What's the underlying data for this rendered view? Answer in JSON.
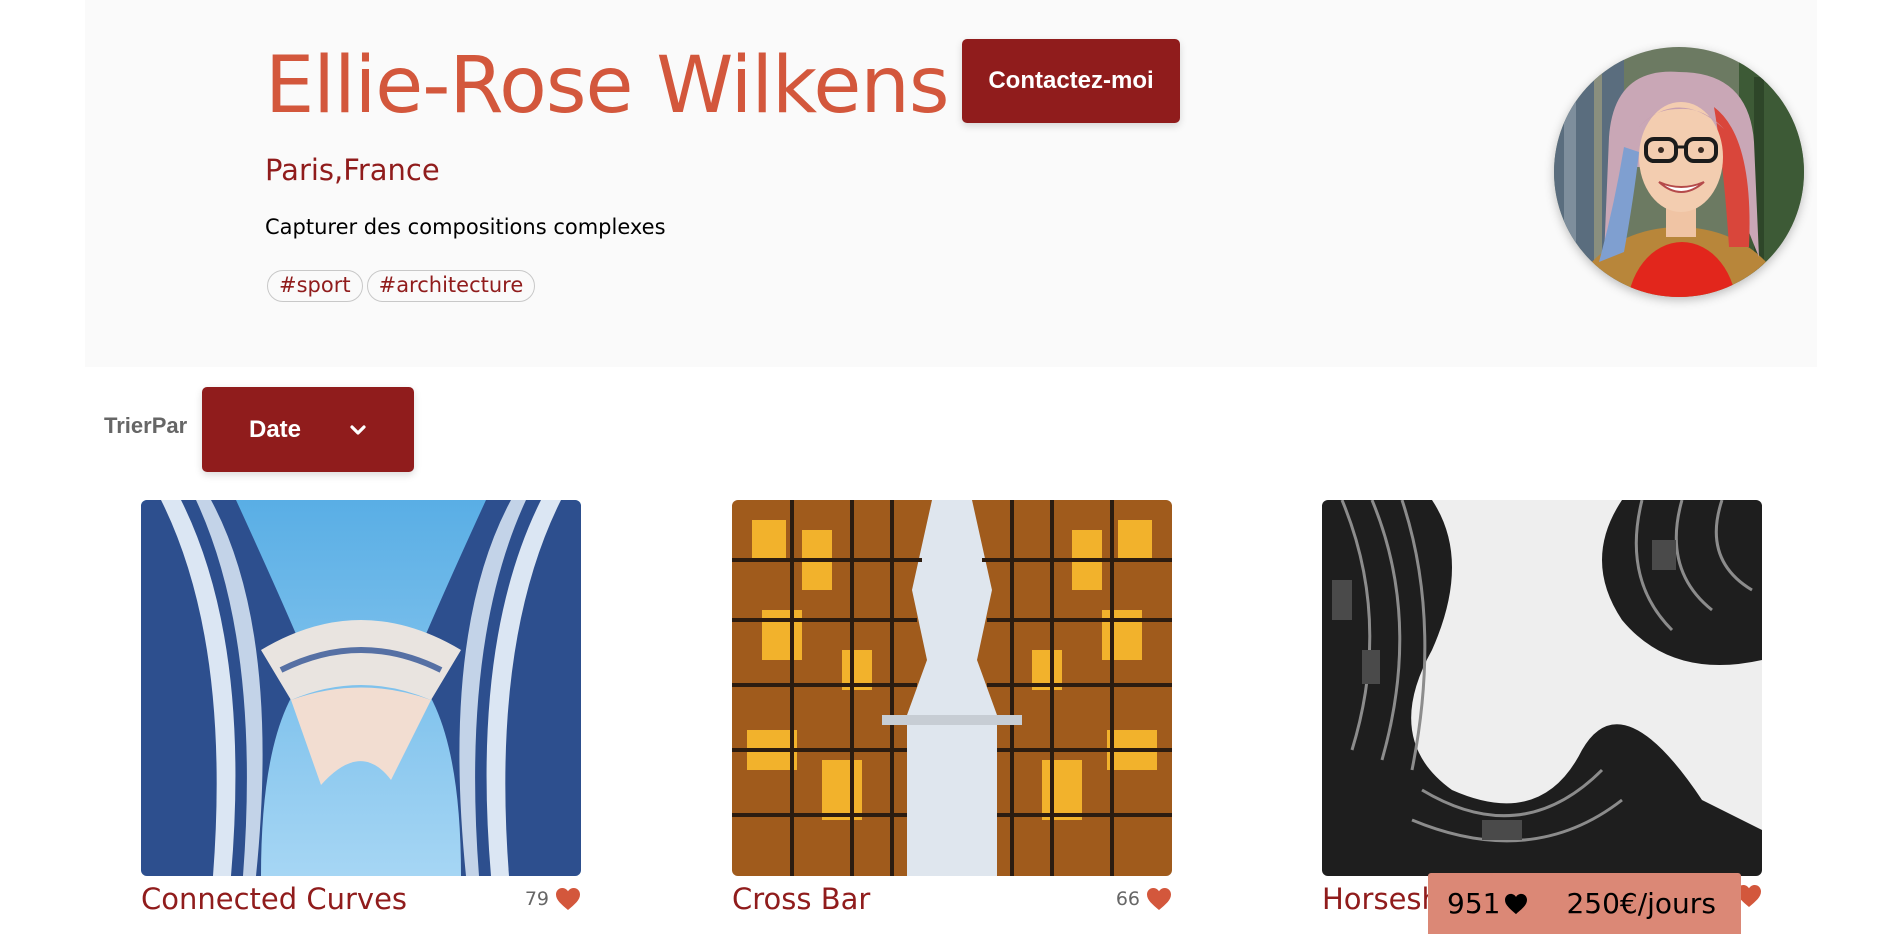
{
  "photographer": {
    "name": "Ellie-Rose Wilkens",
    "location": "Paris,France",
    "tagline": "Capturer des compositions complexes",
    "contact_label": "Contactez-moi",
    "tags": [
      "#sport",
      "#architecture"
    ]
  },
  "sort": {
    "label": "TrierPar",
    "selected": "Date"
  },
  "media": [
    {
      "title": "Connected Curves",
      "likes": "79"
    },
    {
      "title": "Cross Bar",
      "likes": "66"
    },
    {
      "title": "Horseshoe",
      "likes": ""
    }
  ],
  "stats": {
    "total_likes": "951",
    "price": "250€/jours"
  },
  "colors": {
    "primary": "#901c1c",
    "name_accent": "#d3573c",
    "stats_bg": "#db8876",
    "heart": "#d3573c"
  },
  "icons": {
    "dropdown": "chevron-down-icon",
    "like": "heart-icon"
  }
}
